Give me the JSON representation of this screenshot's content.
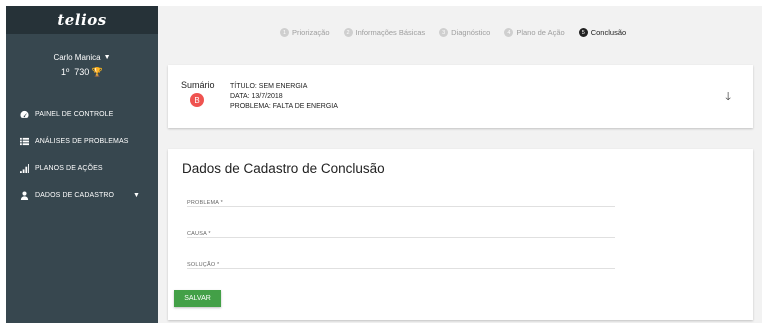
{
  "app": {
    "logo": "telios"
  },
  "user": {
    "name": "Carlo Manica",
    "rank": "1º",
    "points": "730"
  },
  "sidebar": {
    "items": [
      {
        "label": "PAINEL DE CONTROLE",
        "icon": "dashboard-icon"
      },
      {
        "label": "ANÁLISES DE PROBLEMAS",
        "icon": "list-icon"
      },
      {
        "label": "PLANOS DE AÇÕES",
        "icon": "signal-bars-icon"
      },
      {
        "label": "DADOS DE CADASTRO",
        "icon": "person-icon"
      }
    ]
  },
  "stepper": {
    "steps": [
      {
        "num": "1",
        "label": "Priorização"
      },
      {
        "num": "2",
        "label": "Informações Básicas"
      },
      {
        "num": "3",
        "label": "Diagnóstico"
      },
      {
        "num": "4",
        "label": "Plano de Ação"
      },
      {
        "num": "5",
        "label": "Conclusão"
      }
    ]
  },
  "summary": {
    "label": "Sumário",
    "badge": "B",
    "badge_color": "#ef5350",
    "title": "TÍTULO: SEM ENERGIA",
    "date": "DATA: 13/7/2018",
    "problem": "PROBLEMA: FALTA DE ENERGIA"
  },
  "form": {
    "title": "Dados de Cadastro de Conclusão",
    "problem_label": "PROBLEMA *",
    "cause_label": "CAUSA *",
    "solution_label": "SOLUÇÃO *",
    "save_label": "SALVAR"
  },
  "colors": {
    "sidebar": "#37474f",
    "logo_bar": "#263238",
    "save_button": "#43a047"
  }
}
